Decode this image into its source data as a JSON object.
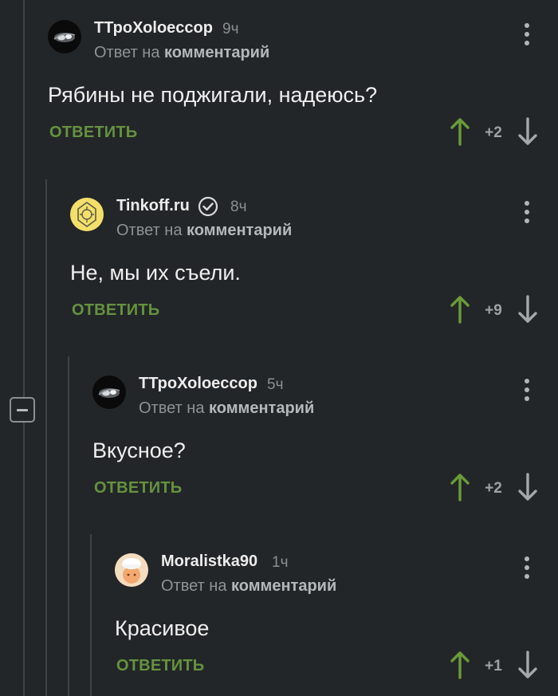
{
  "comments": [
    {
      "author": "ТТроХоloeссор",
      "time": "9ч",
      "reply_prefix": "Ответ на",
      "reply_target": "комментарий",
      "text": "Рябины не поджигали, надеюсь?",
      "reply_label": "ОТВЕТИТЬ",
      "score": "+2",
      "avatar": "headlight-avatar",
      "verified": false
    },
    {
      "author": "Tinkoff.ru",
      "time": "8ч",
      "reply_prefix": "Ответ на",
      "reply_target": "комментарий",
      "text": "Не, мы их съели.",
      "reply_label": "ОТВЕТИТЬ",
      "score": "+9",
      "avatar": "tinkoff-logo-avatar",
      "verified": true
    },
    {
      "author": "ТТроХоloeссор",
      "time": "5ч",
      "reply_prefix": "Ответ на",
      "reply_target": "комментарий",
      "text": "Вкусное?",
      "reply_label": "ОТВЕТИТЬ",
      "score": "+2",
      "avatar": "headlight-avatar",
      "verified": false
    },
    {
      "author": "Moralistka90",
      "time": "1ч",
      "reply_prefix": "Ответ на",
      "reply_target": "комментарий",
      "text": "Красивое",
      "reply_label": "ОТВЕТИТЬ",
      "score": "+1",
      "avatar": "chef-avatar",
      "verified": false
    }
  ],
  "colors": {
    "background": "#232628",
    "reply_green": "#65923f",
    "upvote_green": "#6a9c38",
    "thread_line": "#3f4346"
  },
  "icons": {
    "collapse": "collapse-minus-icon",
    "menu": "more-vertical-icon",
    "upvote": "arrow-up-icon",
    "downvote": "arrow-down-icon",
    "verified": "verified-check-icon"
  }
}
